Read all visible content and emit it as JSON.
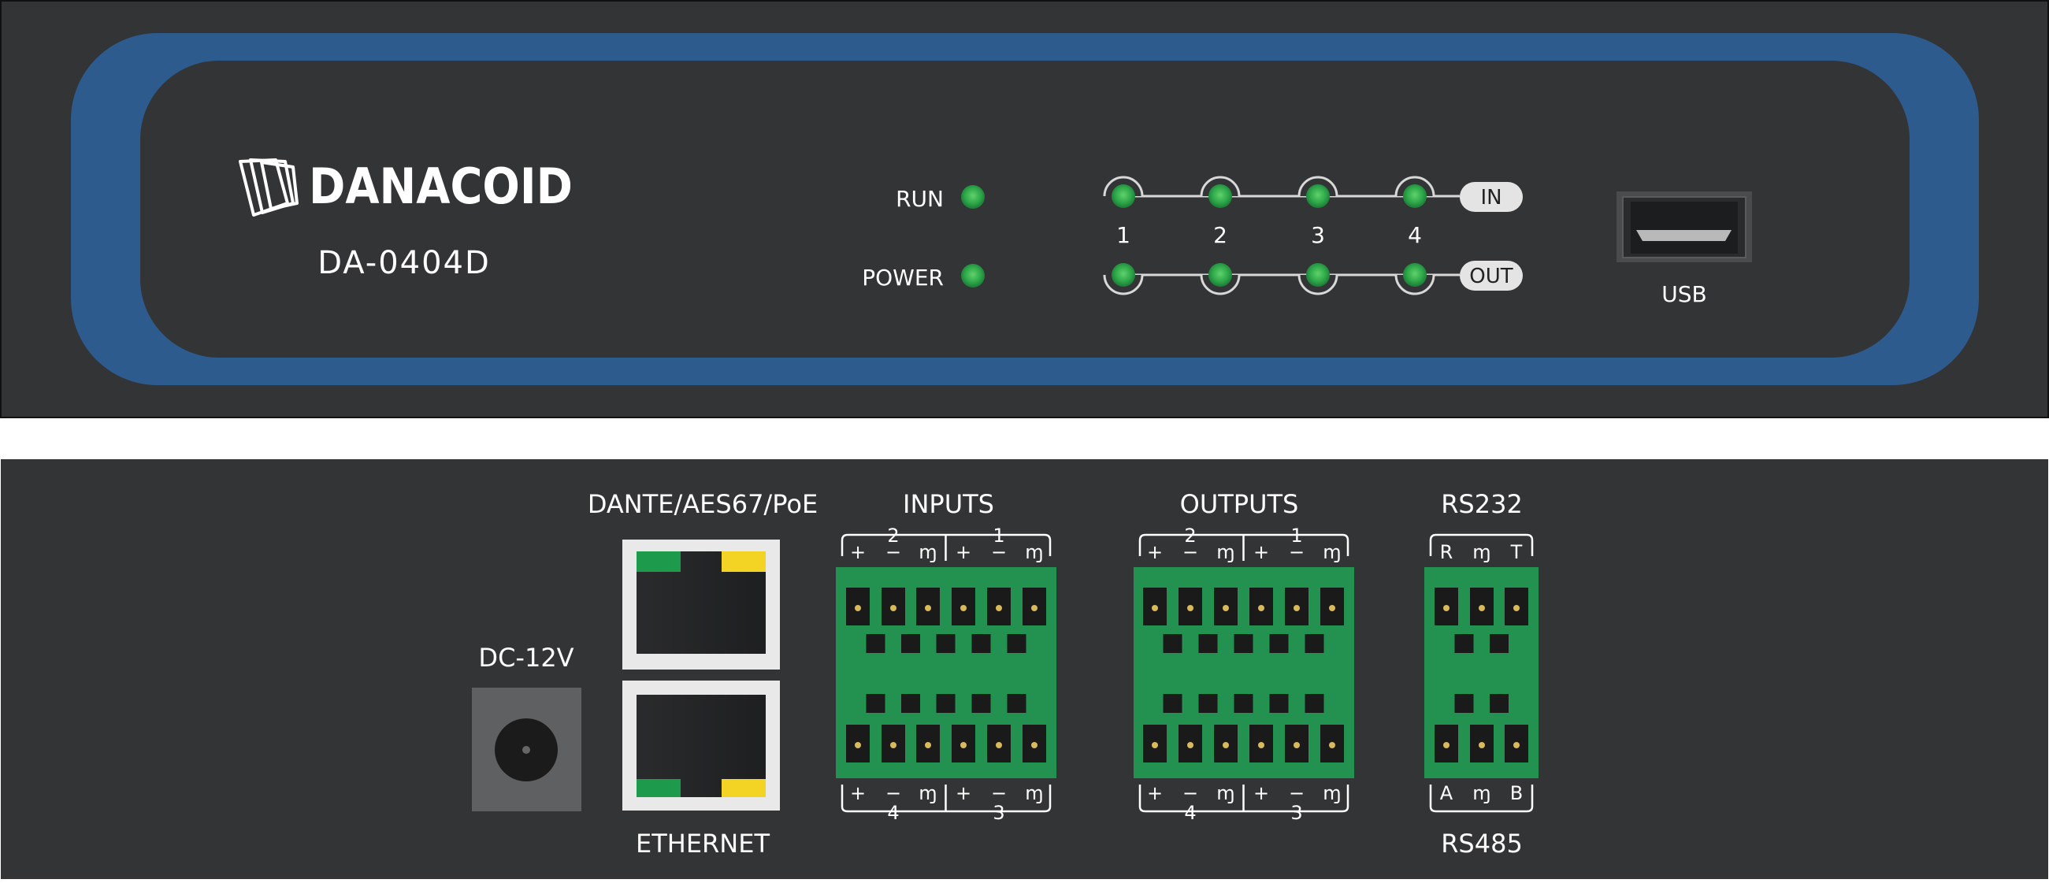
{
  "front": {
    "brand": "DANACOID",
    "model": "DA-0404D",
    "run_label": "RUN",
    "power_label": "POWER",
    "channels": [
      "1",
      "2",
      "3",
      "4"
    ],
    "in_label": "IN",
    "out_label": "OUT",
    "usb_label": "USB"
  },
  "rear": {
    "dc_label": "DC-12V",
    "network_label": "DANTE/AES67/PoE",
    "ethernet_label": "ETHERNET",
    "inputs_label": "INPUTS",
    "outputs_label": "OUTPUTS",
    "rs232_label": "RS232",
    "rs485_label": "RS485",
    "pin_plus": "+",
    "pin_minus": "−",
    "pin_ground": "ɱ",
    "inputs_top_groups": [
      "2",
      "1"
    ],
    "inputs_bottom_groups": [
      "4",
      "3"
    ],
    "outputs_top_groups": [
      "2",
      "1"
    ],
    "outputs_bottom_groups": [
      "4",
      "3"
    ],
    "rs232_pins": [
      "R",
      "ɱ",
      "T"
    ],
    "rs485_pins": [
      "A",
      "ɱ",
      "B"
    ]
  },
  "colors": {
    "chassis": "#333435",
    "bezel_blue": "#2d5b8e",
    "led_green": "#2ea84a",
    "terminal_green": "#239150",
    "rj45_green": "#1e9a4c",
    "rj45_yellow": "#f3d324",
    "dc_jack": "#5f6061"
  }
}
